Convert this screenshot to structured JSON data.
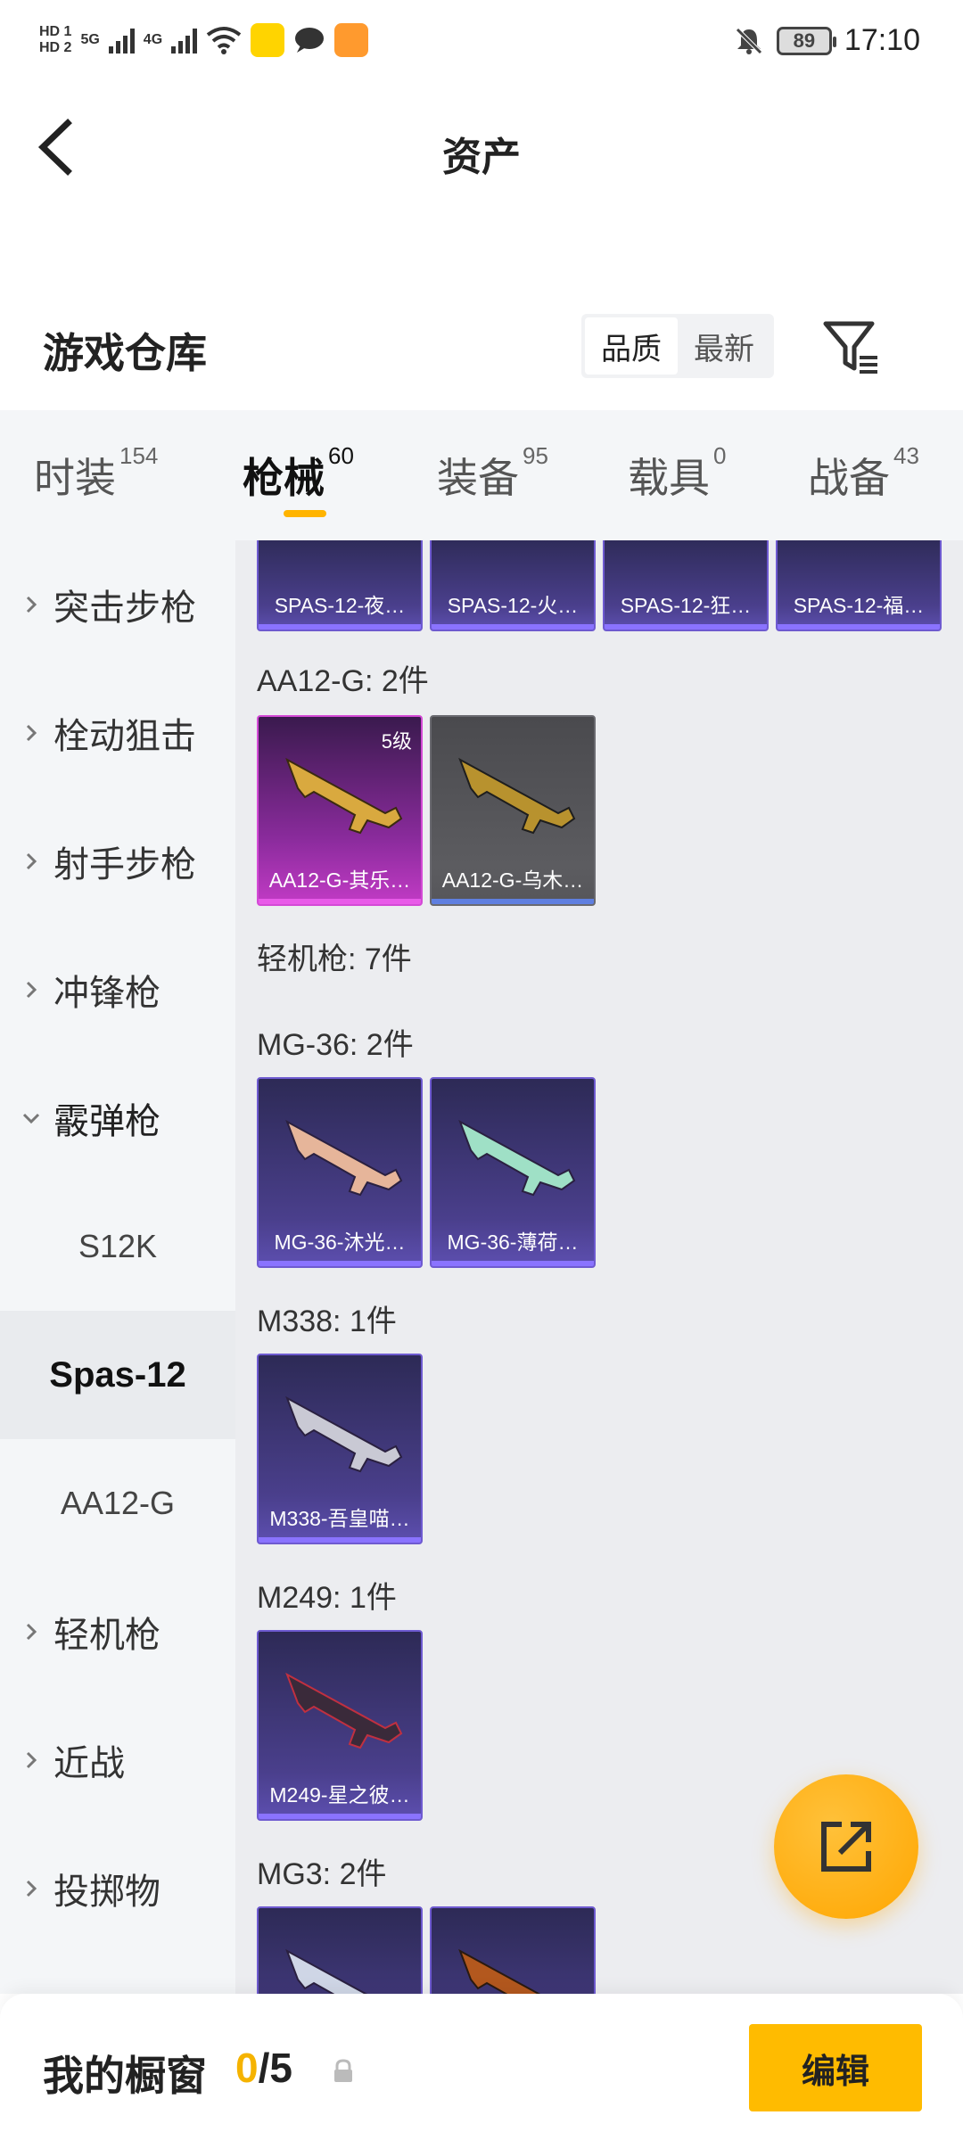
{
  "status_bar": {
    "hd1": "HD 1",
    "hd2": "HD 2",
    "net1": "5G",
    "net2": "4G",
    "battery": "89",
    "time": "17:10"
  },
  "header": {
    "title": "资产"
  },
  "warehouse": {
    "title": "游戏仓库",
    "sort_options": [
      "品质",
      "最新"
    ],
    "sort_selected": "品质"
  },
  "tabs": [
    {
      "label": "时装",
      "count": "154"
    },
    {
      "label": "枪械",
      "count": "60"
    },
    {
      "label": "装备",
      "count": "95"
    },
    {
      "label": "载具",
      "count": "0"
    },
    {
      "label": "战备",
      "count": "43"
    }
  ],
  "active_tab": "枪械",
  "sidebar": {
    "items": [
      {
        "label": "突击步枪"
      },
      {
        "label": "栓动狙击"
      },
      {
        "label": "射手步枪"
      },
      {
        "label": "冲锋枪"
      },
      {
        "label": "霰弹枪"
      }
    ],
    "sub_items": [
      "S12K",
      "Spas-12",
      "AA12-G"
    ],
    "active_sub": "Spas-12",
    "more_items": [
      {
        "label": "轻机枪"
      },
      {
        "label": "近战"
      },
      {
        "label": "投掷物"
      }
    ]
  },
  "main": {
    "top_row": [
      "SPAS-12-夜…",
      "SPAS-12-火…",
      "SPAS-12-狂…",
      "SPAS-12-福…"
    ],
    "groups": [
      {
        "title": "AA12-G: 2件",
        "cards": [
          {
            "label": "AA12-G-其乐…",
            "level": "5级",
            "style": "pink"
          },
          {
            "label": "AA12-G-乌木…",
            "style": "grey"
          }
        ]
      },
      {
        "title": "轻机枪: 7件"
      },
      {
        "title": "MG-36: 2件",
        "cards": [
          {
            "label": "MG-36-沐光…",
            "style": "purple"
          },
          {
            "label": "MG-36-薄荷…",
            "style": "purple"
          }
        ]
      },
      {
        "title": "M338: 1件",
        "cards": [
          {
            "label": "M338-吾皇喵…",
            "style": "purple"
          }
        ]
      },
      {
        "title": "M249: 1件",
        "cards": [
          {
            "label": "M249-星之彼…",
            "style": "purple"
          }
        ]
      },
      {
        "title": "MG3: 2件"
      }
    ]
  },
  "bottom_bar": {
    "title": "我的橱窗",
    "current": "0",
    "total": "/5",
    "edit_label": "编辑"
  },
  "colors": {
    "accent": "#ffbb00",
    "card_purple": "#4a3f8c",
    "card_pink": "#c23bc5",
    "card_grey": "#5c5c60"
  }
}
